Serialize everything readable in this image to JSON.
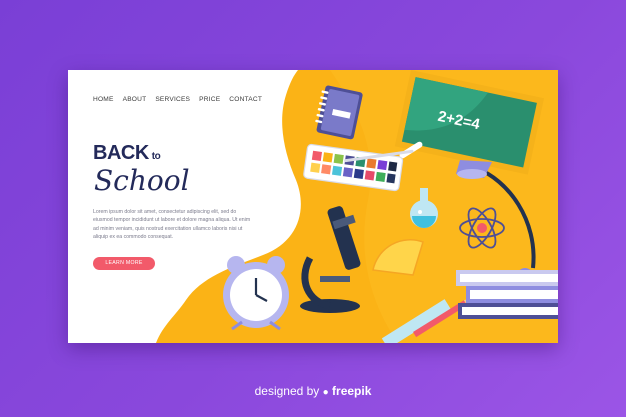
{
  "nav": {
    "items": [
      "HOME",
      "ABOUT",
      "SERVICES",
      "PRICE",
      "CONTACT"
    ]
  },
  "hero": {
    "back": "BACK",
    "to": "to",
    "school": "School",
    "paragraph": "Lorem ipsum dolor sit amet, consectetur adipiscing elit, sed do eiusmod tempor incididunt ut labore et dolore magna aliqua. Ut enim ad minim veniam, quis nostrud exercitation ullamco laboris nisi ut aliquip ex ea commodo consequat.",
    "button_label": "LEARN MORE"
  },
  "chalkboard": {
    "equation": "2+2=4"
  },
  "footer": {
    "designed_by": "designed by",
    "brand": "freepik"
  },
  "colors": {
    "background": "#8448db",
    "accent_yellow": "#fbb316",
    "heading": "#232a5a",
    "button": "#f25a6a"
  }
}
